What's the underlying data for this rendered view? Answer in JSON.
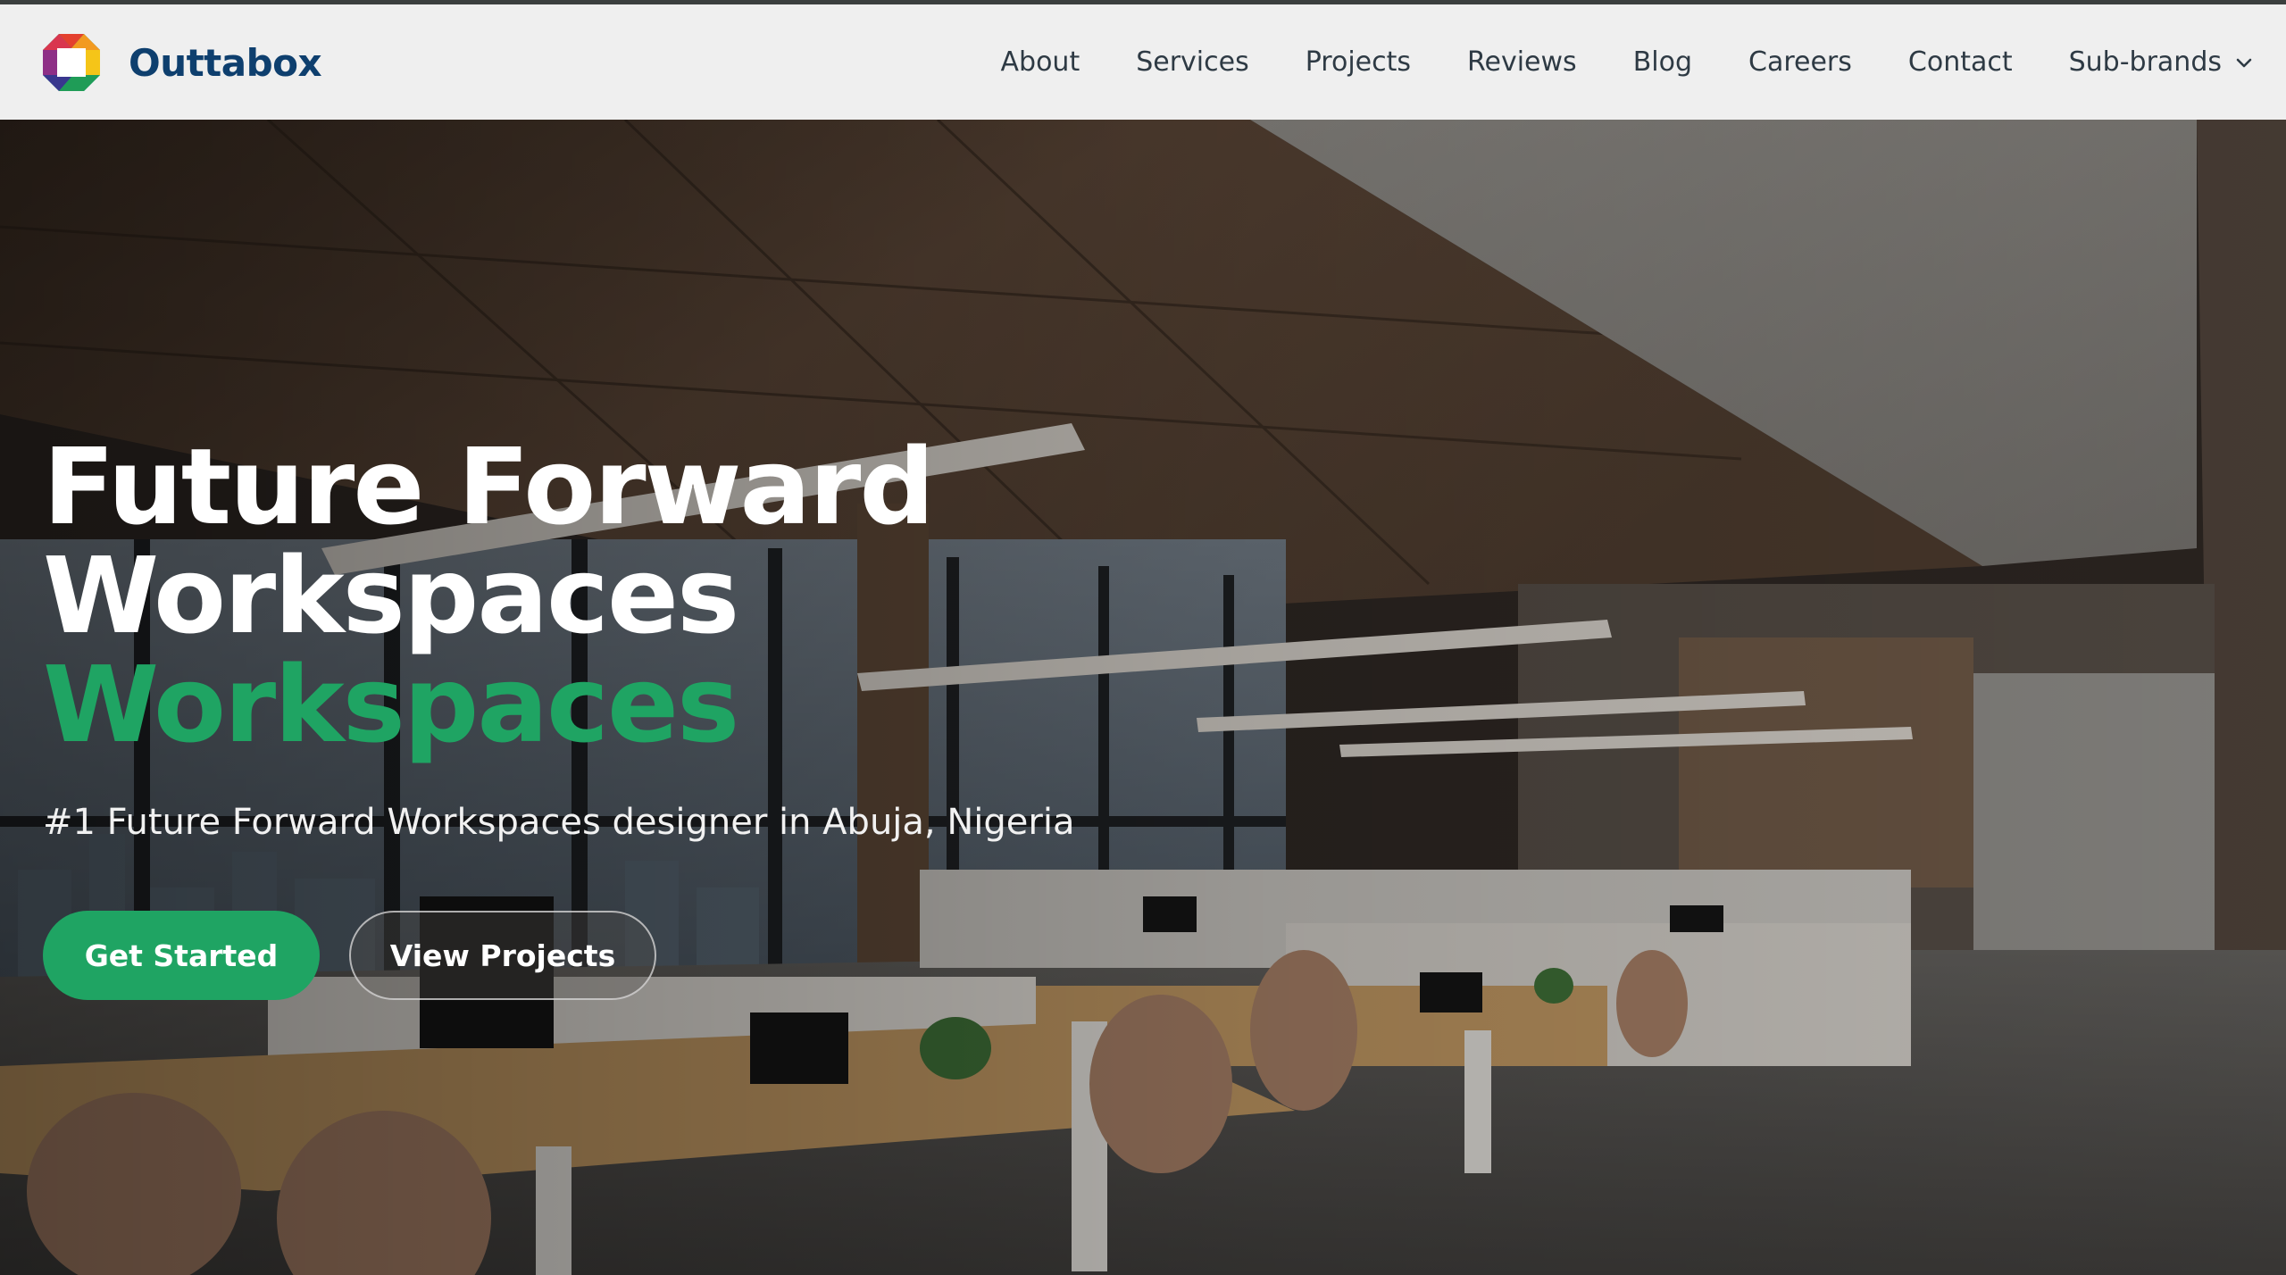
{
  "brand": {
    "name": "Outtabox",
    "logo_icon": "octagon-cube-logo"
  },
  "nav": {
    "items": [
      {
        "label": "About"
      },
      {
        "label": "Services"
      },
      {
        "label": "Projects"
      },
      {
        "label": "Reviews"
      },
      {
        "label": "Blog"
      },
      {
        "label": "Careers"
      },
      {
        "label": "Contact"
      },
      {
        "label": "Sub-brands",
        "icon": "chevron-down-icon"
      }
    ]
  },
  "hero": {
    "headline_line1": "Future Forward",
    "headline_line2": "Workspaces",
    "headline_line3": "Workspaces",
    "subtitle": "#1 Future Forward Workspaces designer in Abuja, Nigeria",
    "primary_button": "Get Started",
    "secondary_button": "View Projects"
  },
  "colors": {
    "accent": "#1fa463",
    "brand_text": "#0e3f6e",
    "nav_bg": "#efefef",
    "nav_text": "#2e3a44"
  }
}
